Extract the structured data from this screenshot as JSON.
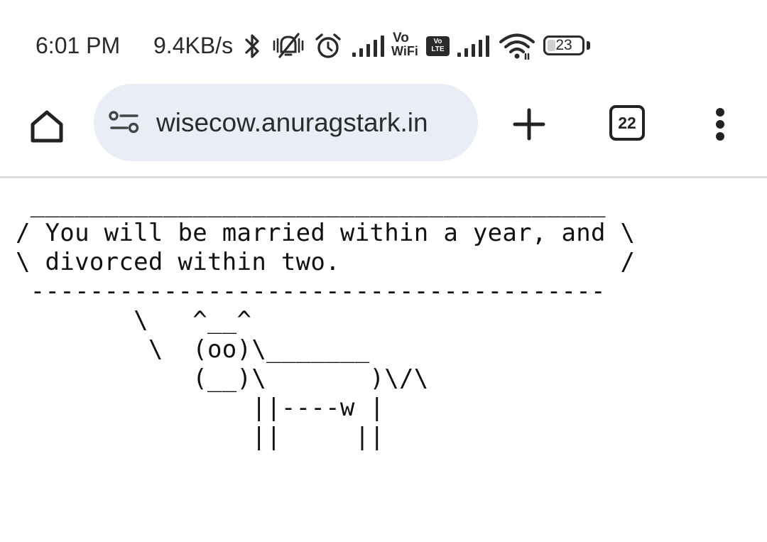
{
  "status_bar": {
    "time": "6:01 PM",
    "network_speed": "9.4KB/s",
    "icons": [
      "bluetooth-icon",
      "vibrate-muted-icon",
      "alarm-icon",
      "signal-icon",
      "vowifi-icon",
      "volte-icon",
      "signal-icon",
      "wifi-icon",
      "battery-icon"
    ],
    "vowifi_top": "Vo",
    "vowifi_bottom": "WiFi",
    "volte_top": "Vo",
    "volte_bottom": "LTE",
    "battery_level": "23",
    "battery_fraction": 0.23
  },
  "browser": {
    "url": "wisecow.anuragstark.in",
    "tab_count": "22",
    "omnibox_color": "#e9edf5"
  },
  "page": {
    "cowsay_text": " _______________________________________\n/ You will be married within a year, and \\\n\\ divorced within two.                   /\n ---------------------------------------\n        \\   ^__^\n         \\  (oo)\\_______\n            (__)\\       )\\/\\\n                ||----w |\n                ||     ||"
  }
}
